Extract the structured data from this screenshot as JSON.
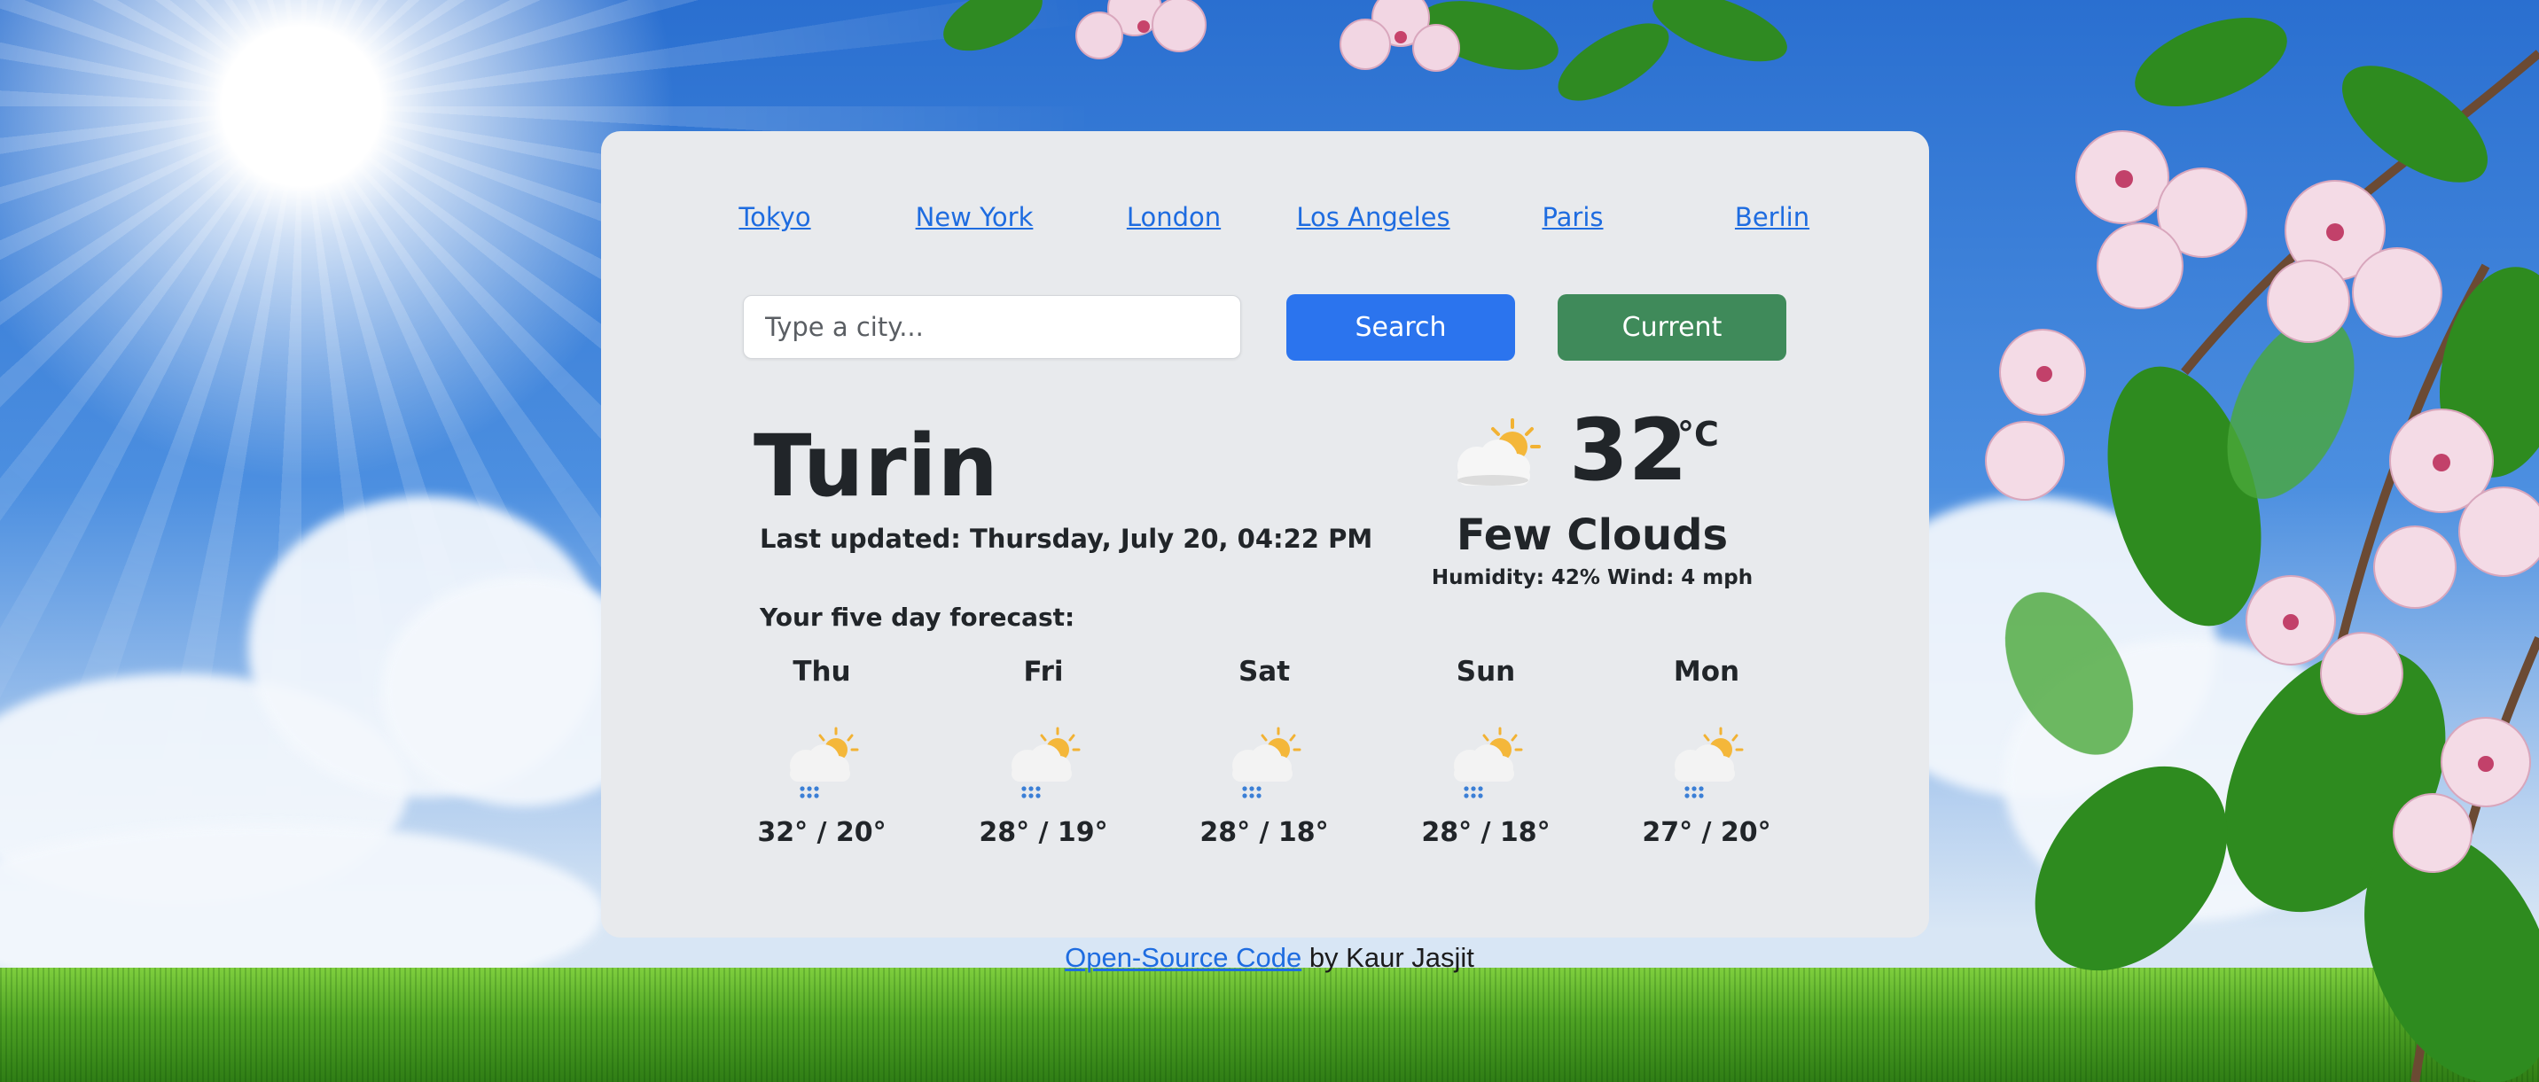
{
  "nav": {
    "cities": [
      "Tokyo",
      "New York",
      "London",
      "Los Angeles",
      "Paris",
      "Berlin"
    ]
  },
  "search": {
    "placeholder": "Type a city...",
    "value": "",
    "search_label": "Search",
    "current_label": "Current"
  },
  "weather": {
    "city": "Turin",
    "last_updated": "Last updated: Thursday, July 20, 04:22 PM",
    "temperature": "32",
    "unit": "°C",
    "description": "Few Clouds",
    "details": "Humidity: 42% Wind: 4 mph",
    "icon": "sun-behind-cloud-icon"
  },
  "forecast": {
    "title": "Your five day forecast:",
    "days": [
      {
        "day": "Thu",
        "temps": "32° / 20°",
        "icon": "sun-cloud-rain-icon"
      },
      {
        "day": "Fri",
        "temps": "28° / 19°",
        "icon": "sun-cloud-rain-icon"
      },
      {
        "day": "Sat",
        "temps": "28° / 18°",
        "icon": "sun-cloud-rain-icon"
      },
      {
        "day": "Sun",
        "temps": "28° / 18°",
        "icon": "sun-cloud-rain-icon"
      },
      {
        "day": "Mon",
        "temps": "27° / 20°",
        "icon": "sun-cloud-rain-icon"
      }
    ]
  },
  "footer": {
    "link_text": "Open-Source Code",
    "by_text": " by Kaur Jasjit"
  },
  "colors": {
    "card_bg": "#e8eaed",
    "link": "#1e6ce0",
    "search_button": "#2b74ee",
    "current_button": "#3f8a5a"
  }
}
